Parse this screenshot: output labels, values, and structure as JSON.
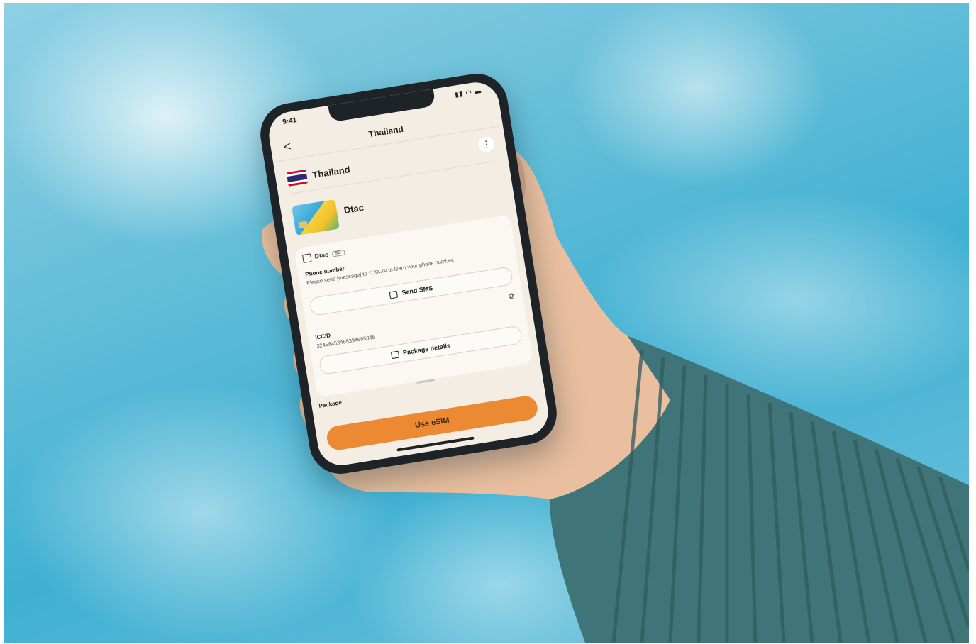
{
  "status_bar": {
    "time": "9:41",
    "icons": "signal-wifi-battery-icons"
  },
  "nav": {
    "back": "<",
    "title": "Thailand"
  },
  "country": {
    "name": "Thailand",
    "menu": "⋮"
  },
  "carrier": {
    "name": "Dtac"
  },
  "sim_card": {
    "sim_label": "Dtac",
    "badge": "5G",
    "phone_number_label": "Phone number",
    "phone_number_hint": "Please send [message] to *1XXX# to learn your phone number.",
    "send_sms_label": "Send SMS",
    "iccid_label": "ICCID",
    "iccid_value": "32468453465394585345",
    "package_details_label": "Package details"
  },
  "package": {
    "label": "Package"
  },
  "cta": {
    "label": "Use eSIM"
  },
  "colors": {
    "accent": "#ec8a33",
    "screen_bg": "#f4ede4",
    "sky": "#3fb0d2",
    "sleeve": "#3f7478"
  }
}
